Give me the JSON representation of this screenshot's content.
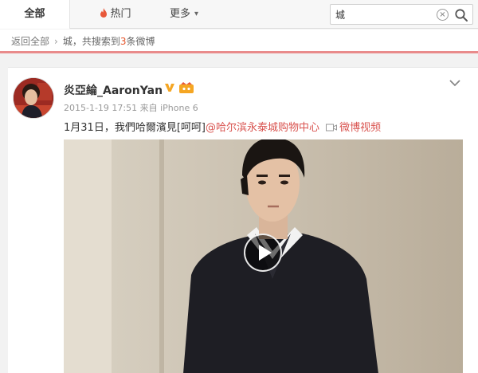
{
  "tabs": [
    {
      "label": "全部",
      "active": true
    },
    {
      "label": "热门",
      "icon": "flame-icon"
    },
    {
      "label": "更多",
      "icon": "chevron-down-icon"
    }
  ],
  "search": {
    "value": "城",
    "clear_icon": "close-icon",
    "button_icon": "search-icon"
  },
  "breadcrumb": {
    "back_label": "返回全部",
    "separator": "›",
    "query_prefix": "城，共搜索到",
    "count": "3",
    "query_suffix": "条微博"
  },
  "post": {
    "username": "炎亞綸_AaronYan",
    "verified_icon": "verified-v-icon",
    "member_icon": "vip-crown-icon",
    "time": "2015-1-19 17:51",
    "source": "来自 iPhone 6",
    "text": "1月31日，我們哈爾濱見[呵呵]",
    "mention": "@哈尔滨永泰城购物中心",
    "video_label": "微博视频",
    "video_icon": "video-camera-icon",
    "menu_icon": "chevron-down-icon",
    "play_icon": "play-icon"
  },
  "colors": {
    "accent_red": "#e98b8b",
    "link_red": "#d9534f",
    "count_orange": "#e5562d",
    "verified_gold": "#f5a623"
  }
}
